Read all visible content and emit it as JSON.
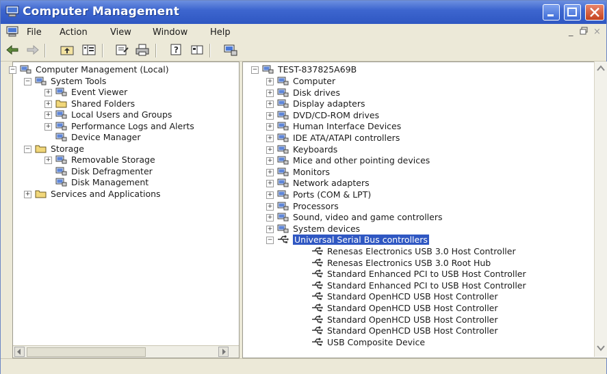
{
  "window": {
    "title": "Computer Management"
  },
  "menu": {
    "items": [
      "File",
      "Action",
      "View",
      "Window",
      "Help"
    ]
  },
  "toolbar": {
    "icons": [
      "back-arrow-icon",
      "forward-arrow-icon",
      "up-folder-icon",
      "show-hide-tree-icon",
      "properties-icon",
      "print-icon",
      "help-icon",
      "console-icon",
      "device-manager-icon"
    ]
  },
  "left_tree": [
    {
      "label": "Computer Management (Local)",
      "icon": "computer-management-icon",
      "level": 0,
      "expander": "minus"
    },
    {
      "label": "System Tools",
      "icon": "tools-icon",
      "level": 1,
      "expander": "minus"
    },
    {
      "label": "Event Viewer",
      "icon": "event-viewer-icon",
      "level": 2,
      "expander": "plus"
    },
    {
      "label": "Shared Folders",
      "icon": "shared-folder-icon",
      "level": 2,
      "expander": "plus"
    },
    {
      "label": "Local Users and Groups",
      "icon": "users-icon",
      "level": 2,
      "expander": "plus"
    },
    {
      "label": "Performance Logs and Alerts",
      "icon": "performance-icon",
      "level": 2,
      "expander": "plus"
    },
    {
      "label": "Device Manager",
      "icon": "device-manager-icon",
      "level": 2,
      "expander": "none"
    },
    {
      "label": "Storage",
      "icon": "storage-icon",
      "level": 1,
      "expander": "minus"
    },
    {
      "label": "Removable Storage",
      "icon": "removable-storage-icon",
      "level": 2,
      "expander": "plus"
    },
    {
      "label": "Disk Defragmenter",
      "icon": "defrag-icon",
      "level": 2,
      "expander": "none"
    },
    {
      "label": "Disk Management",
      "icon": "disk-management-icon",
      "level": 2,
      "expander": "none"
    },
    {
      "label": "Services and Applications",
      "icon": "services-icon",
      "level": 1,
      "expander": "plus"
    }
  ],
  "right_tree": {
    "root": "TEST-837825A69B",
    "categories": [
      "Computer",
      "Disk drives",
      "Display adapters",
      "DVD/CD-ROM drives",
      "Human Interface Devices",
      "IDE ATA/ATAPI controllers",
      "Keyboards",
      "Mice and other pointing devices",
      "Monitors",
      "Network adapters",
      "Ports (COM & LPT)",
      "Processors",
      "Sound, video and game controllers",
      "System devices",
      "Universal Serial Bus controllers"
    ],
    "selected": "Universal Serial Bus controllers",
    "usb_devices": [
      "Renesas Electronics USB 3.0 Host Controller",
      "Renesas Electronics USB 3.0 Root Hub",
      "Standard Enhanced PCI to USB Host Controller",
      "Standard Enhanced PCI to USB Host Controller",
      "Standard OpenHCD USB Host Controller",
      "Standard OpenHCD USB Host Controller",
      "Standard OpenHCD USB Host Controller",
      "Standard OpenHCD USB Host Controller",
      "USB Composite Device"
    ]
  },
  "colors": {
    "titlebar": "#2f57c2",
    "selection": "#2f57c2",
    "pane_bg": "#ffffff",
    "chrome": "#ece9d8"
  }
}
